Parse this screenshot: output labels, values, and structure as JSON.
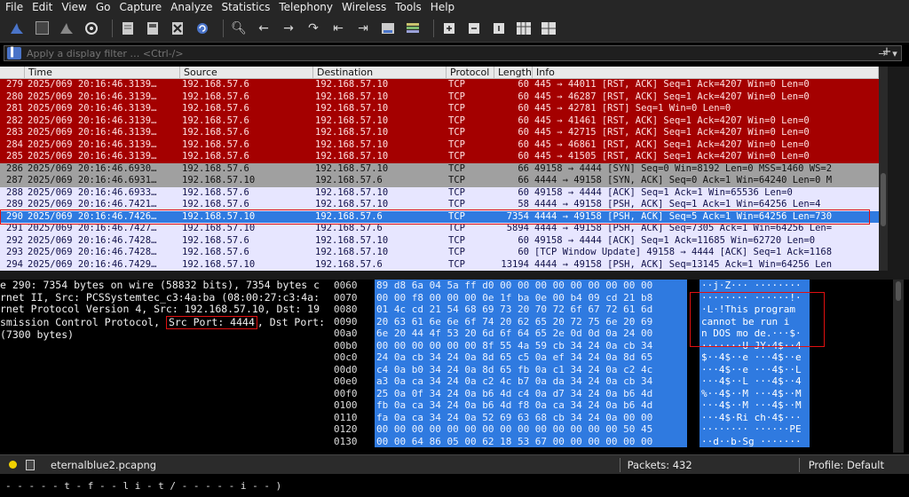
{
  "menu": [
    "File",
    "Edit",
    "View",
    "Go",
    "Capture",
    "Analyze",
    "Statistics",
    "Telephony",
    "Wireless",
    "Tools",
    "Help"
  ],
  "filter": {
    "placeholder": "Apply a display filter … <Ctrl-/>",
    "right_arrow": "→",
    "plus": "+"
  },
  "columns": [
    "Time",
    "Source",
    "Destination",
    "Protocol",
    "Length",
    "Info"
  ],
  "packets": [
    {
      "no": "279",
      "time": "2025/069 20:16:46.3139…",
      "src": "192.168.57.6",
      "dst": "192.168.57.10",
      "proto": "TCP",
      "len": "60",
      "info": "445 → 44011 [RST, ACK] Seq=1 Ack=4207 Win=0 Len=0",
      "style": "red"
    },
    {
      "no": "280",
      "time": "2025/069 20:16:46.3139…",
      "src": "192.168.57.6",
      "dst": "192.168.57.10",
      "proto": "TCP",
      "len": "60",
      "info": "445 → 46287 [RST, ACK] Seq=1 Ack=4207 Win=0 Len=0",
      "style": "red"
    },
    {
      "no": "281",
      "time": "2025/069 20:16:46.3139…",
      "src": "192.168.57.6",
      "dst": "192.168.57.10",
      "proto": "TCP",
      "len": "60",
      "info": "445 → 42781 [RST] Seq=1 Win=0 Len=0",
      "style": "red"
    },
    {
      "no": "282",
      "time": "2025/069 20:16:46.3139…",
      "src": "192.168.57.6",
      "dst": "192.168.57.10",
      "proto": "TCP",
      "len": "60",
      "info": "445 → 41461 [RST, ACK] Seq=1 Ack=4207 Win=0 Len=0",
      "style": "red"
    },
    {
      "no": "283",
      "time": "2025/069 20:16:46.3139…",
      "src": "192.168.57.6",
      "dst": "192.168.57.10",
      "proto": "TCP",
      "len": "60",
      "info": "445 → 42715 [RST, ACK] Seq=1 Ack=4207 Win=0 Len=0",
      "style": "red"
    },
    {
      "no": "284",
      "time": "2025/069 20:16:46.3139…",
      "src": "192.168.57.6",
      "dst": "192.168.57.10",
      "proto": "TCP",
      "len": "60",
      "info": "445 → 46861 [RST, ACK] Seq=1 Ack=4207 Win=0 Len=0",
      "style": "red"
    },
    {
      "no": "285",
      "time": "2025/069 20:16:46.3139…",
      "src": "192.168.57.6",
      "dst": "192.168.57.10",
      "proto": "TCP",
      "len": "60",
      "info": "445 → 41505 [RST, ACK] Seq=1 Ack=4207 Win=0 Len=0",
      "style": "red"
    },
    {
      "no": "286",
      "time": "2025/069 20:16:46.6930…",
      "src": "192.168.57.6",
      "dst": "192.168.57.10",
      "proto": "TCP",
      "len": "66",
      "info": "49158 → 4444 [SYN] Seq=0 Win=8192 Len=0 MSS=1460 WS=2",
      "style": "gray"
    },
    {
      "no": "287",
      "time": "2025/069 20:16:46.6931…",
      "src": "192.168.57.10",
      "dst": "192.168.57.6",
      "proto": "TCP",
      "len": "66",
      "info": "4444 → 49158 [SYN, ACK] Seq=0 Ack=1 Win=64240 Len=0 M",
      "style": "gray"
    },
    {
      "no": "288",
      "time": "2025/069 20:16:46.6933…",
      "src": "192.168.57.6",
      "dst": "192.168.57.10",
      "proto": "TCP",
      "len": "60",
      "info": "49158 → 4444 [ACK] Seq=1 Ack=1 Win=65536 Len=0",
      "style": "lav"
    },
    {
      "no": "289",
      "time": "2025/069 20:16:46.7421…",
      "src": "192.168.57.6",
      "dst": "192.168.57.10",
      "proto": "TCP",
      "len": "58",
      "info": "4444 → 49158 [PSH, ACK] Seq=1 Ack=1 Win=64256 Len=4",
      "style": "lav"
    },
    {
      "no": "290",
      "time": "2025/069 20:16:46.7426…",
      "src": "192.168.57.10",
      "dst": "192.168.57.6",
      "proto": "TCP",
      "len": "7354",
      "info": "4444 → 49158 [PSH, ACK] Seq=5 Ack=1 Win=64256 Len=730",
      "style": "sel"
    },
    {
      "no": "291",
      "time": "2025/069 20:16:46.7427…",
      "src": "192.168.57.10",
      "dst": "192.168.57.6",
      "proto": "TCP",
      "len": "5894",
      "info": "4444 → 49158 [PSH, ACK] Seq=7305 Ack=1 Win=64256 Len=",
      "style": "lav"
    },
    {
      "no": "292",
      "time": "2025/069 20:16:46.7428…",
      "src": "192.168.57.6",
      "dst": "192.168.57.10",
      "proto": "TCP",
      "len": "60",
      "info": "49158 → 4444 [ACK] Seq=1 Ack=11685 Win=62720 Len=0",
      "style": "lav"
    },
    {
      "no": "293",
      "time": "2025/069 20:16:46.7428…",
      "src": "192.168.57.6",
      "dst": "192.168.57.10",
      "proto": "TCP",
      "len": "60",
      "info": "[TCP Window Update] 49158 → 4444 [ACK] Seq=1 Ack=1168",
      "style": "lav"
    },
    {
      "no": "294",
      "time": "2025/069 20:16:46.7429…",
      "src": "192.168.57.10",
      "dst": "192.168.57.6",
      "proto": "TCP",
      "len": "13194",
      "info": "4444 → 49158 [PSH, ACK] Seq=13145 Ack=1 Win=64256 Len",
      "style": "lav"
    }
  ],
  "details": {
    "line1": "e 290: 7354 bytes on wire (58832 bits), 7354 bytes c",
    "line2": "rnet II, Src: PCSSystemtec_c3:4a:ba (08:00:27:c3:4a:",
    "line3": "rnet Protocol Version 4, Src: 192.168.57.10, Dst: 19",
    "line4_pre": "smission Control Protocol, ",
    "line4_port": "Src Port: 4444",
    "line4_post": ", Dst Port:",
    "line5": " (7300 bytes)"
  },
  "bytes": [
    {
      "off": "0060",
      "hex": "89 d8 6a 04 5a ff d0 00  00 00 00 00 00 00 00 00",
      "asc": "··j·Z··· ········"
    },
    {
      "off": "0070",
      "hex": "00 00 f8 00 00 00 0e 1f  ba 0e 00 b4 09 cd 21 b8",
      "asc": "········ ······!·"
    },
    {
      "off": "0080",
      "hex": "01 4c cd 21 54 68 69 73  20 70 72 6f 67 72 61 6d",
      "asc": "·L·!This  program"
    },
    {
      "off": "0090",
      "hex": "20 63 61 6e 6e 6f 74 20  62 65 20 72 75 6e 20 69",
      "asc": " cannot  be run i"
    },
    {
      "off": "00a0",
      "hex": "6e 20 44 4f 53 20 6d 6f  64 65 2e 0d 0d 0a 24 00",
      "asc": "n DOS mo de.···$·"
    },
    {
      "off": "00b0",
      "hex": "00 00 00 00 00 00 8f 55  4a 59 cb 34 24 0a cb 34",
      "asc": "·······U JY·4$··4"
    },
    {
      "off": "00c0",
      "hex": "24 0a cb 34 24 0a 8d 65  c5 0a ef 34 24 0a 8d 65",
      "asc": "$··4$··e ···4$··e"
    },
    {
      "off": "00d0",
      "hex": "c4 0a b0 34 24 0a 8d 65  fb 0a c1 34 24 0a c2 4c",
      "asc": "···4$··e ···4$··L"
    },
    {
      "off": "00e0",
      "hex": "a3 0a ca 34 24 0a c2 4c  b7 0a da 34 24 0a cb 34",
      "asc": "···4$··L ···4$··4"
    },
    {
      "off": "00f0",
      "hex": "25 0a 0f 34 24 0a b6 4d  c4 0a d7 34 24 0a b6 4d",
      "asc": "%··4$··M ···4$··M"
    },
    {
      "off": "0100",
      "hex": "fb 0a ca 34 24 0a b6 4d  f8 0a ca 34 24 0a b6 4d",
      "asc": "···4$··M ···4$··M"
    },
    {
      "off": "0110",
      "hex": "fa 0a ca 34 24 0a 52 69  63 68 cb 34 24 0a 00 00",
      "asc": "···4$·Ri ch·4$···"
    },
    {
      "off": "0120",
      "hex": "00 00 00 00 00 00 00 00  00 00 00 00 00 00 50 45",
      "asc": "········ ······PE"
    },
    {
      "off": "0130",
      "hex": "00 00 64 86 05 00 62 18  53 67 00 00 00 00 00 00",
      "asc": "··d··b·Sg ·······"
    }
  ],
  "status": {
    "file": "eternalblue2.pcapng",
    "packets": "Packets: 432",
    "profile": "Profile: Default"
  },
  "terminal_text": "- - - - - t - f - - l i - t / - - - - - i - - )",
  "colors": {
    "red_row": "#a40000",
    "gray_row": "#a0a0a0",
    "lav_row": "#e7e6ff",
    "selected_row": "#2f7ae0",
    "highlight_box": "#e01010"
  }
}
